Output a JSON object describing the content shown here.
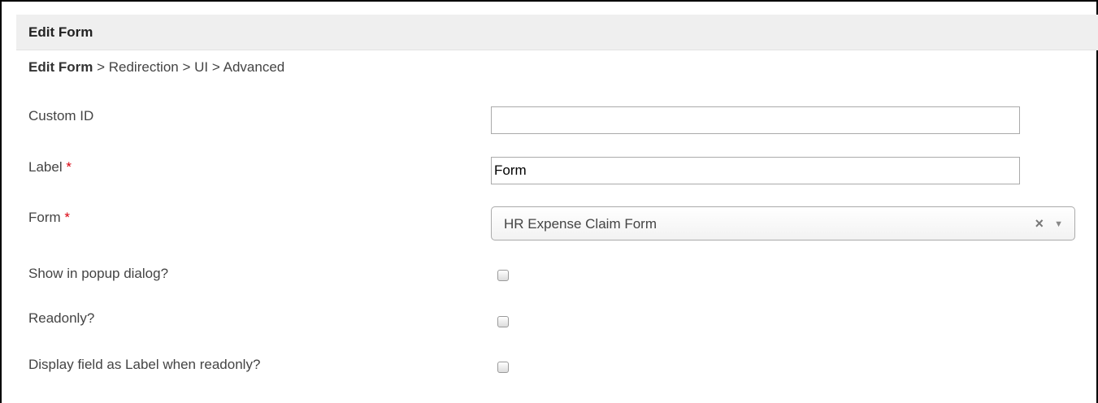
{
  "header": {
    "title": "Edit Form"
  },
  "breadcrumb": {
    "current": "Edit Form",
    "separator": ">",
    "steps": [
      "Redirection",
      "UI",
      "Advanced"
    ]
  },
  "fields": {
    "custom_id": {
      "label": "Custom ID",
      "value": ""
    },
    "label": {
      "label": "Label",
      "required_mark": "*",
      "value": "Form"
    },
    "form": {
      "label": "Form",
      "required_mark": "*",
      "selected": "HR Expense Claim Form",
      "clear_glyph": "×",
      "arrow_glyph": "▼"
    },
    "show_in_popup": {
      "label": "Show in popup dialog?",
      "checked": false
    },
    "readonly": {
      "label": "Readonly?",
      "checked": false
    },
    "display_as_label": {
      "label": "Display field as Label when readonly?",
      "checked": false
    }
  },
  "colors": {
    "required": "#d9000d",
    "header_bg": "#efefef"
  }
}
